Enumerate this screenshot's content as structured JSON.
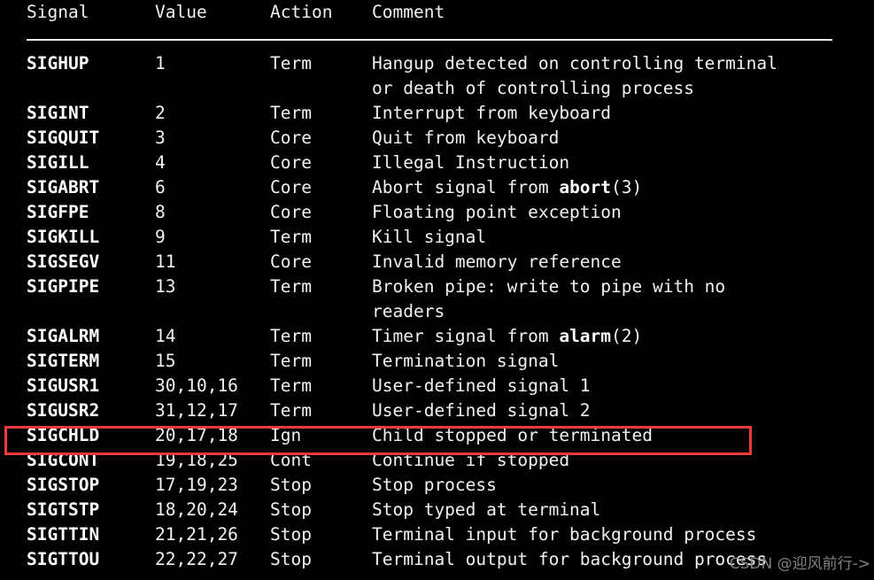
{
  "page": {
    "background_color": "#000000",
    "text_color": "#f2f2f2",
    "accent_color": "#ef3b3b"
  },
  "table": {
    "headers": {
      "signal": "Signal",
      "value": "Value",
      "action": "Action",
      "comment": "Comment"
    },
    "rows": [
      {
        "signal": "SIGHUP",
        "value": "1",
        "action": "Term",
        "comment": "Hangup detected on controlling terminal",
        "comment_cont": "or death of controlling process",
        "highlighted": false
      },
      {
        "signal": "SIGINT",
        "value": "2",
        "action": "Term",
        "comment": "Interrupt from keyboard",
        "comment_cont": "",
        "highlighted": false
      },
      {
        "signal": "SIGQUIT",
        "value": "3",
        "action": "Core",
        "comment": "Quit from keyboard",
        "comment_cont": "",
        "highlighted": false
      },
      {
        "signal": "SIGILL",
        "value": "4",
        "action": "Core",
        "comment": "Illegal Instruction",
        "comment_cont": "",
        "highlighted": false
      },
      {
        "signal": "SIGABRT",
        "value": "6",
        "action": "Core",
        "comment_pre": "Abort signal from ",
        "comment_bold": "abort",
        "comment_post": "(3)",
        "comment": "Abort signal from abort(3)",
        "comment_cont": "",
        "highlighted": false
      },
      {
        "signal": "SIGFPE",
        "value": "8",
        "action": "Core",
        "comment": "Floating point exception",
        "comment_cont": "",
        "highlighted": false
      },
      {
        "signal": "SIGKILL",
        "value": "9",
        "action": "Term",
        "comment": "Kill signal",
        "comment_cont": "",
        "highlighted": false
      },
      {
        "signal": "SIGSEGV",
        "value": "11",
        "action": "Core",
        "comment": "Invalid memory reference",
        "comment_cont": "",
        "highlighted": false
      },
      {
        "signal": "SIGPIPE",
        "value": "13",
        "action": "Term",
        "comment": "Broken pipe: write to pipe with no",
        "comment_cont": "readers",
        "highlighted": false
      },
      {
        "signal": "SIGALRM",
        "value": "14",
        "action": "Term",
        "comment_pre": "Timer signal from ",
        "comment_bold": "alarm",
        "comment_post": "(2)",
        "comment": "Timer signal from alarm(2)",
        "comment_cont": "",
        "highlighted": false
      },
      {
        "signal": "SIGTERM",
        "value": "15",
        "action": "Term",
        "comment": "Termination signal",
        "comment_cont": "",
        "highlighted": false
      },
      {
        "signal": "SIGUSR1",
        "value": "30,10,16",
        "action": "Term",
        "comment": "User-defined signal 1",
        "comment_cont": "",
        "highlighted": false
      },
      {
        "signal": "SIGUSR2",
        "value": "31,12,17",
        "action": "Term",
        "comment": "User-defined signal 2",
        "comment_cont": "",
        "highlighted": false
      },
      {
        "signal": "SIGCHLD",
        "value": "20,17,18",
        "action": "Ign",
        "comment": "Child stopped or terminated",
        "comment_cont": "",
        "highlighted": true
      },
      {
        "signal": "SIGCONT",
        "value": "19,18,25",
        "action": "Cont",
        "comment": "Continue if stopped",
        "comment_cont": "",
        "highlighted": false
      },
      {
        "signal": "SIGSTOP",
        "value": "17,19,23",
        "action": "Stop",
        "comment": "Stop process",
        "comment_cont": "",
        "highlighted": false
      },
      {
        "signal": "SIGTSTP",
        "value": "18,20,24",
        "action": "Stop",
        "comment": "Stop typed at terminal",
        "comment_cont": "",
        "highlighted": false
      },
      {
        "signal": "SIGTTIN",
        "value": "21,21,26",
        "action": "Stop",
        "comment": "Terminal input for background process",
        "comment_cont": "",
        "highlighted": false
      },
      {
        "signal": "SIGTTOU",
        "value": "22,22,27",
        "action": "Stop",
        "comment": "Terminal output for background process",
        "comment_cont": "",
        "highlighted": false
      }
    ]
  },
  "watermark": {
    "text": "CSDN @迎风前行->"
  }
}
